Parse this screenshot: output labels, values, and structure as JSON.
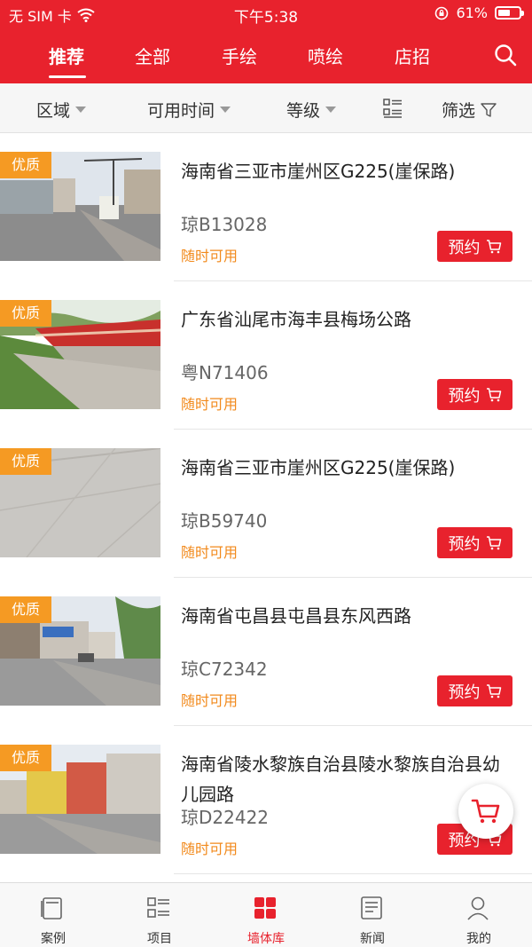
{
  "status_bar": {
    "carrier": "无 SIM 卡",
    "time": "下午5:38",
    "battery": "61%",
    "battery_level": 0.61
  },
  "top_tabs": [
    {
      "label": "推荐",
      "active": true
    },
    {
      "label": "全部",
      "active": false
    },
    {
      "label": "手绘",
      "active": false
    },
    {
      "label": "喷绘",
      "active": false
    },
    {
      "label": "店招",
      "active": false
    }
  ],
  "filters": {
    "region": "区域",
    "available_time": "可用时间",
    "grade": "等级",
    "filter": "筛选"
  },
  "items": [
    {
      "badge": "优质",
      "title": "海南省三亚市崖州区G225(崖保路)",
      "plate": "琼B13028",
      "availability": "随时可用",
      "button": "预约"
    },
    {
      "badge": "优质",
      "title": "广东省汕尾市海丰县梅场公路",
      "plate": "粤N71406",
      "availability": "随时可用",
      "button": "预约"
    },
    {
      "badge": "优质",
      "title": "海南省三亚市崖州区G225(崖保路)",
      "plate": "琼B59740",
      "availability": "随时可用",
      "button": "预约"
    },
    {
      "badge": "优质",
      "title": "海南省屯昌县屯昌县东风西路",
      "plate": "琼C72342",
      "availability": "随时可用",
      "button": "预约"
    },
    {
      "badge": "优质",
      "title": "海南省陵水黎族自治县陵水黎族自治县幼儿园路",
      "plate": "琼D22422",
      "availability": "随时可用",
      "button": "预约"
    }
  ],
  "bottom_nav": [
    {
      "label": "案例",
      "icon": "case-icon",
      "active": false
    },
    {
      "label": "项目",
      "icon": "project-icon",
      "active": false
    },
    {
      "label": "墙体库",
      "icon": "wall-library-icon",
      "active": true
    },
    {
      "label": "新闻",
      "icon": "news-icon",
      "active": false
    },
    {
      "label": "我的",
      "icon": "profile-icon",
      "active": false
    }
  ],
  "colors": {
    "brand": "#e8222d",
    "badge": "#f59a23",
    "availability": "#f28a1c"
  }
}
